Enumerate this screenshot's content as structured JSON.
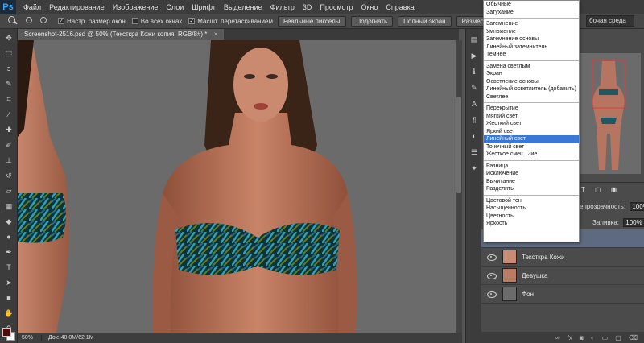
{
  "app": {
    "logo": "Ps"
  },
  "menu": [
    "Файл",
    "Редактирование",
    "Изображение",
    "Слои",
    "Шрифт",
    "Выделение",
    "Фильтр",
    "3D",
    "Просмотр",
    "Окно",
    "Справка"
  ],
  "options": {
    "check_resize": "Настр. размер окон",
    "check_all_windows": "Во всех окнах",
    "check_scrubby": "Масшт. перетаскиванием",
    "btn_actual": "Реальные пикселы",
    "btn_fit": "Подогнать",
    "btn_fullscreen": "Полный экран",
    "btn_print": "Размер оттиска",
    "workspace": "бочая среда"
  },
  "document": {
    "tab_title": "Screenshot-2516.psd @ 50% (Тексткра Кожи копия, RGB/8#) *",
    "close": "×"
  },
  "status": {
    "zoom": "50%",
    "doc": "Док: 40,0M/62,1M"
  },
  "colors": {
    "foreground": "#4a0d0d",
    "background": "#ffffff",
    "highlight": "#3a78d6",
    "selected_layer": "#5d6a80"
  },
  "blend_modes": [
    [
      "Обычные",
      "Затухание"
    ],
    [
      "Затемнение",
      "Умножение",
      "Затемнение основы",
      "Линейный затемнитель",
      "Темнее"
    ],
    [
      "Замена светлым",
      "Экран",
      "Осветление основы",
      "Линейный осветлитель (добавить)",
      "Светлее"
    ],
    [
      "Перекрытие",
      "Мягкий свет",
      "Жесткий свет",
      "Яркий свет",
      "Линейный свет",
      "Точечный свет",
      "Жесткое смешение"
    ],
    [
      "Разница",
      "Исключение",
      "Вычитание",
      "Разделить"
    ],
    [
      "Цветовой тон",
      "Насыщенность",
      "Цветность",
      "Яркость"
    ]
  ],
  "blend_selected": "Линейный свет",
  "layers_panel": {
    "opacity_label": "епрозрачность:",
    "opacity_value": "100%",
    "fill_label": "Заливка:",
    "fill_value": "100%",
    "layers": [
      {
        "name": "Тексткра Кожи"
      },
      {
        "name": "Девушка"
      },
      {
        "name": "Фон"
      }
    ],
    "footer_icons": [
      "link-icon",
      "fx-icon",
      "mask-icon",
      "adjustment-icon",
      "folder-icon",
      "new-layer-icon",
      "trash-icon"
    ]
  }
}
